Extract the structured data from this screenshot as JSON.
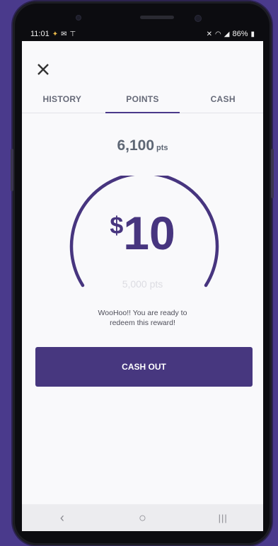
{
  "status_bar": {
    "time": "11:01",
    "left_icons": [
      "app-icon",
      "notification-icon",
      "cast-icon"
    ],
    "battery": "86%",
    "right_icons": [
      "mute-icon",
      "wifi-icon",
      "signal-icon",
      "battery-icon"
    ]
  },
  "header": {
    "close_icon": "close-icon"
  },
  "tabs": [
    {
      "label": "HISTORY",
      "active": false
    },
    {
      "label": "POINTS",
      "active": true
    },
    {
      "label": "CASH",
      "active": false
    }
  ],
  "balance": {
    "value": "6,100",
    "unit": "pts"
  },
  "reward": {
    "currency_symbol": "$",
    "amount": "10",
    "cost": "5,000 pts"
  },
  "message": "WooHoo!! You are ready to redeem this reward!",
  "cashout_label": "CASH OUT",
  "navbar": {
    "back": "‹",
    "home": "○",
    "recents": "|||"
  },
  "colors": {
    "accent": "#47377f",
    "background": "#4a3a8c"
  }
}
